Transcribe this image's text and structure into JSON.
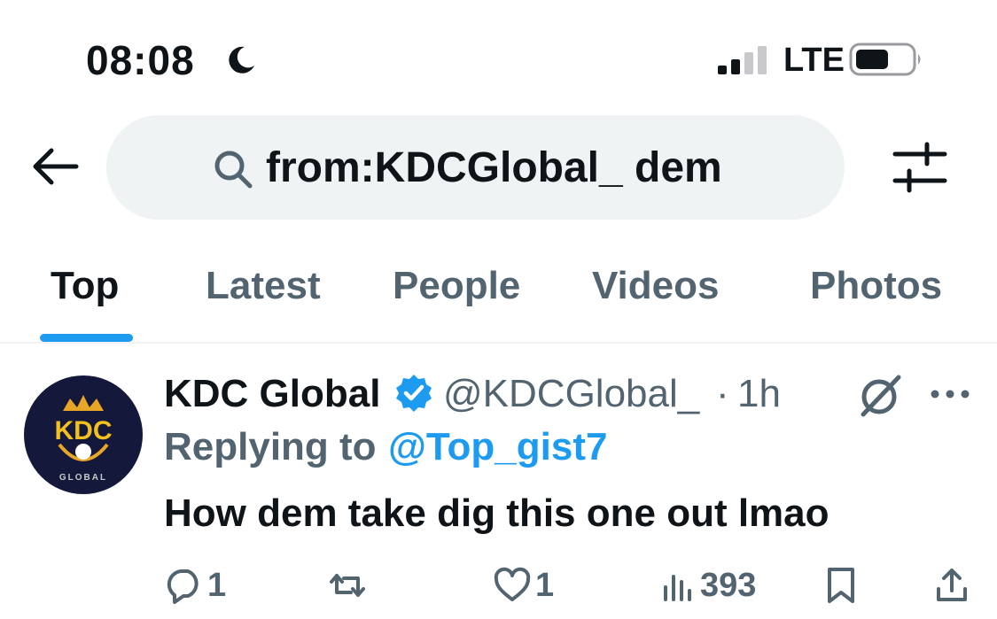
{
  "status_bar": {
    "time": "08:08",
    "network": "LTE"
  },
  "header": {
    "search_query": "from:KDCGlobal_ dem"
  },
  "tabs": [
    {
      "label": "Top",
      "active": true
    },
    {
      "label": "Latest",
      "active": false
    },
    {
      "label": "People",
      "active": false
    },
    {
      "label": "Videos",
      "active": false
    },
    {
      "label": "Photos",
      "active": false
    }
  ],
  "tweet": {
    "avatar_text": "KDC",
    "avatar_subtext": "GLOBAL",
    "author": "KDC Global",
    "handle": "@KDCGlobal_",
    "separator": "·",
    "time": "1h",
    "reply_prefix": "Replying to",
    "reply_to": "@Top_gist7",
    "text": "How dem take dig this one out lmao",
    "actions": {
      "replies": "1",
      "reposts": "",
      "likes": "1",
      "views": "393"
    }
  },
  "colors": {
    "accent": "#1d9bf0",
    "text": "#0f1419",
    "muted": "#536471",
    "search_bg": "#eff3f4"
  }
}
